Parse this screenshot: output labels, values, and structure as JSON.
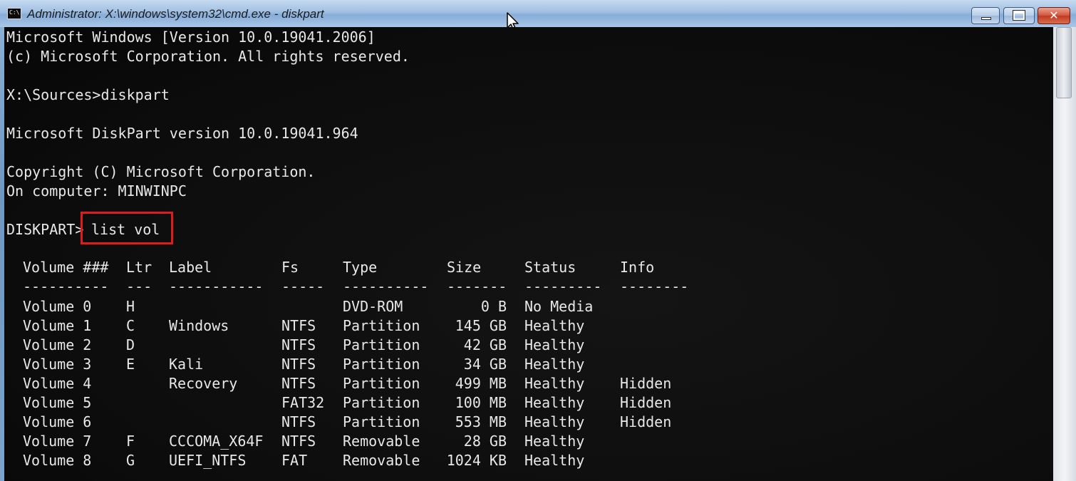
{
  "window": {
    "title": "Administrator: X:\\windows\\system32\\cmd.exe - diskpart",
    "icon_label": "C:\\",
    "buttons": {
      "minimize": "minimize-icon",
      "maximize": "maximize-icon",
      "close_glyph": "✕"
    }
  },
  "console": {
    "lines": [
      "Microsoft Windows [Version 10.0.19041.2006]",
      "(c) Microsoft Corporation. All rights reserved.",
      "",
      "X:\\Sources>diskpart",
      "",
      "Microsoft DiskPart version 10.0.19041.964",
      "",
      "Copyright (C) Microsoft Corporation.",
      "On computer: MINWINPC",
      ""
    ],
    "prompt": "DISKPART>",
    "command": "list vol",
    "table": {
      "headers": [
        "Volume ###",
        "Ltr",
        "Label",
        "Fs",
        "Type",
        "Size",
        "Status",
        "Info"
      ],
      "separators": [
        "----------",
        "---",
        "-----------",
        "-----",
        "----------",
        "-------",
        "---------",
        "--------"
      ],
      "rows": [
        [
          "Volume 0",
          "H",
          "",
          "",
          "DVD-ROM",
          "0 B",
          "No Media",
          ""
        ],
        [
          "Volume 1",
          "C",
          "Windows",
          "NTFS",
          "Partition",
          "145 GB",
          "Healthy",
          ""
        ],
        [
          "Volume 2",
          "D",
          "",
          "NTFS",
          "Partition",
          "42 GB",
          "Healthy",
          ""
        ],
        [
          "Volume 3",
          "E",
          "Kali",
          "NTFS",
          "Partition",
          "34 GB",
          "Healthy",
          ""
        ],
        [
          "Volume 4",
          "",
          "Recovery",
          "NTFS",
          "Partition",
          "499 MB",
          "Healthy",
          "Hidden"
        ],
        [
          "Volume 5",
          "",
          "",
          "FAT32",
          "Partition",
          "100 MB",
          "Healthy",
          "Hidden"
        ],
        [
          "Volume 6",
          "",
          "",
          "NTFS",
          "Partition",
          "553 MB",
          "Healthy",
          "Hidden"
        ],
        [
          "Volume 7",
          "F",
          "CCCOMA_X64F",
          "NTFS",
          "Removable",
          "28 GB",
          "Healthy",
          ""
        ],
        [
          "Volume 8",
          "G",
          "UEFI_NTFS",
          "FAT",
          "Removable",
          "1024 KB",
          "Healthy",
          ""
        ]
      ]
    }
  },
  "colors": {
    "console_background": "#0c0c0c",
    "console_text": "#e8e8e8",
    "highlight_box": "#e21a1a",
    "close_button": "#c03a20"
  }
}
